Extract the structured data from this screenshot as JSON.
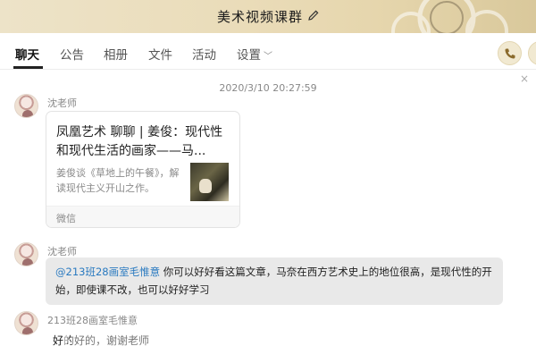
{
  "window": {
    "title": "美术视频课群",
    "edit_icon": "pencil-icon"
  },
  "tabs": [
    {
      "label": "聊天",
      "active": true
    },
    {
      "label": "公告"
    },
    {
      "label": "相册"
    },
    {
      "label": "文件"
    },
    {
      "label": "活动"
    },
    {
      "label": "设置"
    }
  ],
  "header_buttons": {
    "call_icon": "phone-icon",
    "more_icon": "plus-icon",
    "close": "×"
  },
  "chat": {
    "timestamp": "2020/3/10 20:27:59",
    "messages": [
      {
        "sender": "沈老师",
        "type": "link-card",
        "card": {
          "title": "凤凰艺术 聊聊 | 姜俊：现代性和现代生活的画家——马...",
          "description": "姜俊谈《草地上的午餐》，解读现代主义开山之作。",
          "source": "微信"
        }
      },
      {
        "sender": "沈老师",
        "type": "text",
        "mention": "@213班28画室毛惟意",
        "text": " 你可以好好看这篇文章，马奈在西方艺术史上的地位很高，是现代性的开始，即使课不改，也可以好好学习"
      },
      {
        "sender": "213班28画室毛惟意",
        "type": "text",
        "text": "好的好的，谢谢老师"
      }
    ]
  },
  "colors": {
    "accent_gold": "#e6d6ad",
    "mention_blue": "#2a7ac0"
  }
}
